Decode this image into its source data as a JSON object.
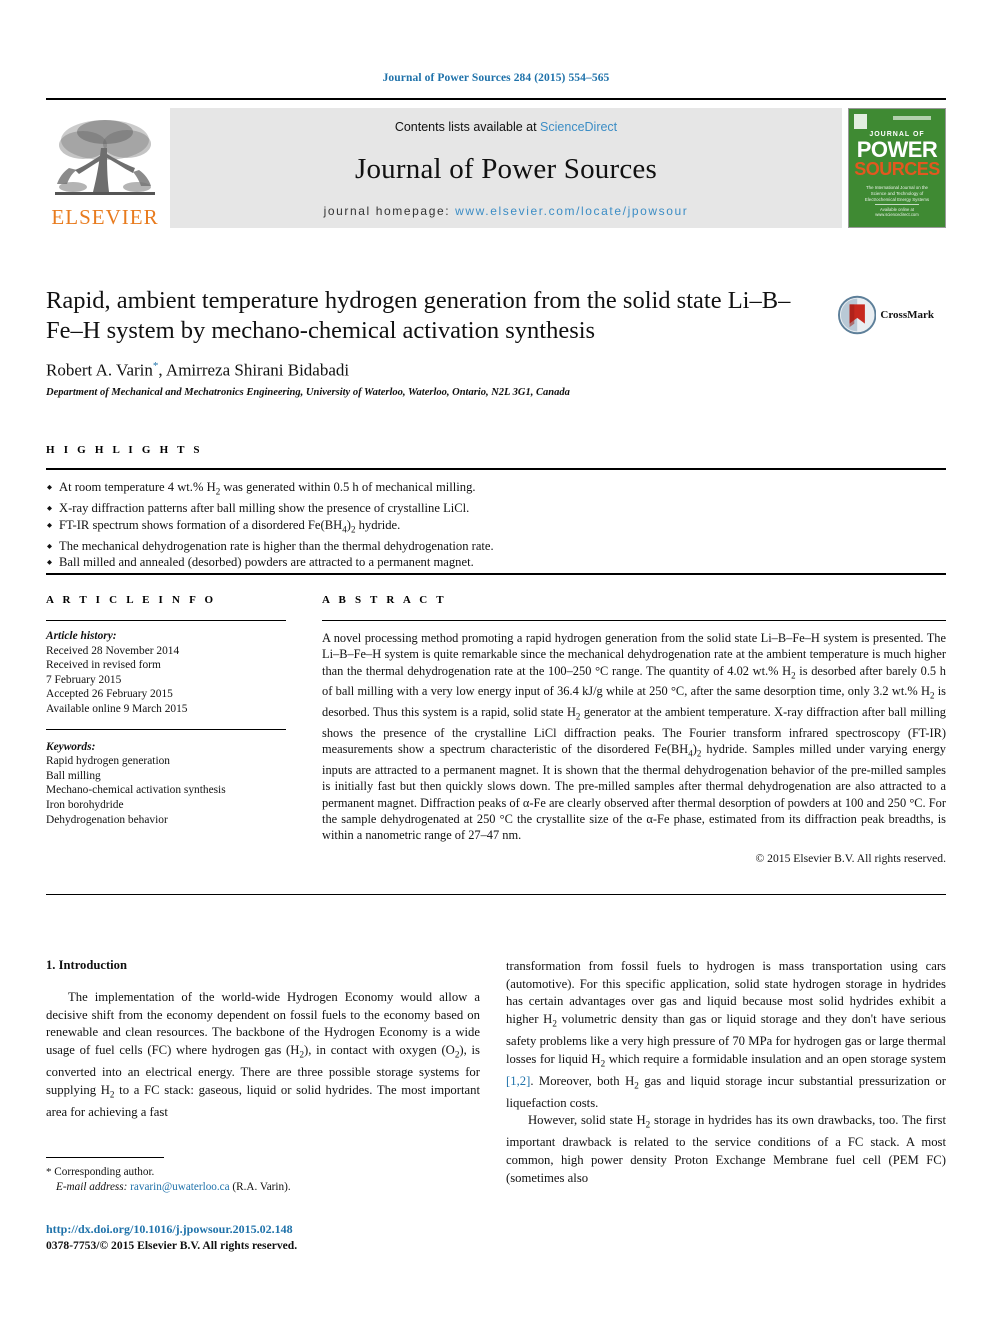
{
  "running_head": "Journal of Power Sources 284 (2015) 554–565",
  "colors": {
    "link_blue": "#1f72aa",
    "sciencedirect_blue": "#3c8dc5",
    "elsevier_orange": "#e87b1e",
    "cover_green": "#3f8a33",
    "cover_orange": "#e2581f",
    "masthead_grey": "#e6e6e6"
  },
  "masthead": {
    "publisher_name": "ELSEVIER",
    "contents_prefix": "Contents lists available at ",
    "contents_link": "ScienceDirect",
    "journal_name": "Journal of Power Sources",
    "homepage_prefix": "journal homepage: ",
    "homepage_link": "www.elsevier.com/locate/jpowsour",
    "cover": {
      "line1": "JOURNAL OF",
      "line2": "POWER",
      "line3": "SOURCES",
      "blurb": "The International Journal on the Science and Technology of Electrochemical Energy Systems",
      "footer": "Available online at www.sciencedirect.com"
    }
  },
  "article": {
    "title": "Rapid, ambient temperature hydrogen generation from the solid state Li–B–Fe–H system by mechano-chemical activation synthesis",
    "authors_part1": "Robert A. Varin",
    "author_marker": "*",
    "authors_part2": ", Amirreza Shirani Bidabadi",
    "affiliation": "Department of Mechanical and Mechatronics Engineering, University of Waterloo, Waterloo, Ontario, N2L 3G1, Canada",
    "crossmark_label": "CrossMark"
  },
  "highlights": {
    "label": "H I G H L I G H T S",
    "items": [
      "At room temperature 4 wt.% H2 was generated within 0.5 h of mechanical milling.",
      "X-ray diffraction patterns after ball milling show the presence of crystalline LiCl.",
      "FT-IR spectrum shows formation of a disordered Fe(BH4)2 hydride.",
      "The mechanical dehydrogenation rate is higher than the thermal dehydrogenation rate.",
      "Ball milled and annealed (desorbed) powders are attracted to a permanent magnet."
    ]
  },
  "article_info": {
    "label": "A R T I C L E   I N F O",
    "history_head": "Article history:",
    "history_lines": [
      "Received 28 November 2014",
      "Received in revised form",
      "7 February 2015",
      "Accepted 26 February 2015",
      "Available online 9 March 2015"
    ],
    "keywords_head": "Keywords:",
    "keywords": [
      "Rapid hydrogen generation",
      "Ball milling",
      "Mechano-chemical activation synthesis",
      "Iron borohydride",
      "Dehydrogenation behavior"
    ]
  },
  "abstract": {
    "label": "A B S T R A C T",
    "text": "A novel processing method promoting a rapid hydrogen generation from the solid state Li–B–Fe–H system is presented. The Li–B–Fe–H system is quite remarkable since the mechanical dehydrogenation rate at the ambient temperature is much higher than the thermal dehydrogenation rate at the 100–250 °C range. The quantity of 4.02 wt.% H2 is desorbed after barely 0.5 h of ball milling with a very low energy input of 36.4 kJ/g while at 250 °C, after the same desorption time, only 3.2 wt.% H2 is desorbed. Thus this system is a rapid, solid state H2 generator at the ambient temperature. X-ray diffraction after ball milling shows the presence of the crystalline LiCl diffraction peaks. The Fourier transform infrared spectroscopy (FT-IR) measurements show a spectrum characteristic of the disordered Fe(BH4)2 hydride. Samples milled under varying energy inputs are attracted to a permanent magnet. It is shown that the thermal dehydrogenation behavior of the pre-milled samples is initially fast but then quickly slows down. The pre-milled samples after thermal dehydrogenation are also attracted to a permanent magnet. Diffraction peaks of α-Fe are clearly observed after thermal desorption of powders at 100 and 250 °C. For the sample dehydrogenated at 250 °C the crystallite size of the α-Fe phase, estimated from its diffraction peak breadths, is within a nanometric range of 27–47 nm.",
    "copyright": "© 2015 Elsevier B.V. All rights reserved."
  },
  "body": {
    "section_number_title": "1.  Introduction",
    "left_paragraph": "The implementation of the world-wide Hydrogen Economy would allow a decisive shift from the economy dependent on fossil fuels to the economy based on renewable and clean resources. The backbone of the Hydrogen Economy is a wide usage of fuel cells (FC) where hydrogen gas (H2), in contact with oxygen (O2), is converted into an electrical energy. There are three possible storage systems for supplying H2 to a FC stack: gaseous, liquid or solid hydrides. The most important area for achieving a fast",
    "right_paragraph_1_pre": "transformation from fossil fuels to hydrogen is mass transportation using cars (automotive). For this specific application, solid state hydrogen storage in hydrides has certain advantages over gas and liquid because most solid hydrides exhibit a higher H2 volumetric density than gas or liquid storage and they don't have serious safety problems like a very high pressure of 70 MPa for hydrogen gas or large thermal losses for liquid H2 which require a formidable insulation and an open storage system ",
    "right_reference": "[1,2]",
    "right_paragraph_1_post": ". Moreover, both H2 gas and liquid storage incur substantial pressurization or liquefaction costs.",
    "right_paragraph_2": "However, solid state H2 storage in hydrides has its own drawbacks, too. The first important drawback is related to the service conditions of a FC stack. A most common, high power density Proton Exchange Membrane fuel cell (PEM FC) (sometimes also"
  },
  "footnote": {
    "corresponding": "Corresponding author.",
    "email_label": "E-mail address:",
    "email": "ravarin@uwaterloo.ca",
    "email_suffix": "(R.A. Varin)."
  },
  "footer": {
    "doi": "http://dx.doi.org/10.1016/j.jpowsour.2015.02.148",
    "issn": "0378-7753/© 2015 Elsevier B.V. All rights reserved."
  }
}
